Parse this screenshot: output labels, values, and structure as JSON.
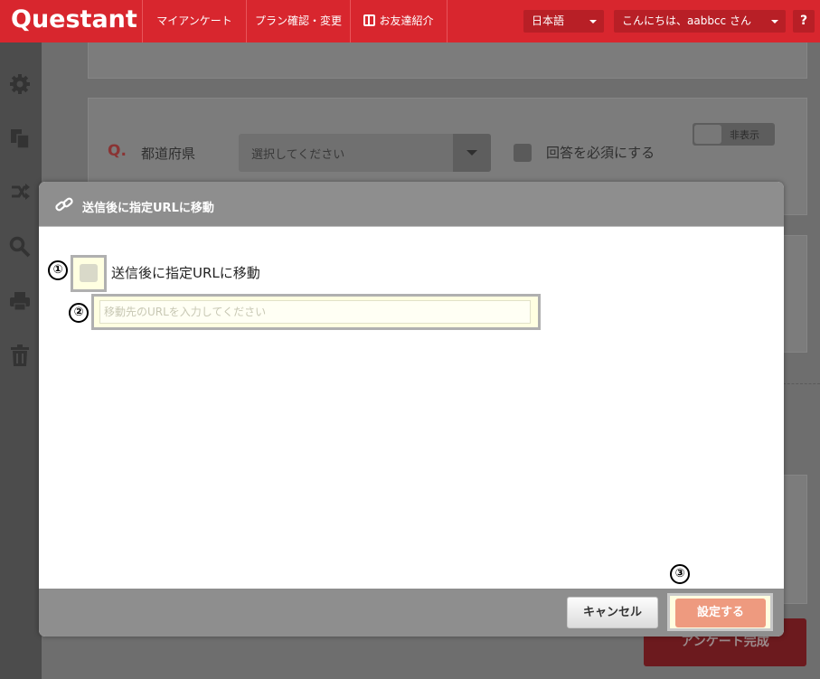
{
  "app": {
    "logo_text": "Questant",
    "nav": [
      {
        "label": "マイアンケート"
      },
      {
        "label": "プラン確認・変更"
      },
      {
        "label": "お友達紹介"
      }
    ],
    "language": "日本語",
    "greeting": "こんにちは、aabbcc さん",
    "help": "?"
  },
  "sidebar": {
    "icons": [
      "gear-icon",
      "copy-icon",
      "share-icon",
      "search-icon",
      "print-icon",
      "trash-icon"
    ]
  },
  "background": {
    "question_mark": "Q.",
    "question_label": "都道府県",
    "select_placeholder": "選択してください",
    "required_label": "回答を必須にする",
    "toggle_label": "非表示",
    "complete_button": "アンケート完成"
  },
  "modal": {
    "title": "送信後に指定URLに移動",
    "checkbox_label": "送信後に指定URLに移動",
    "url_placeholder": "移動先のURLを入力してください",
    "cancel_label": "キャンセル",
    "ok_label": "設定する",
    "step_markers": [
      "①",
      "②",
      "③"
    ]
  },
  "colors": {
    "brand_red": "#d8262e",
    "highlight": "#ffffe1",
    "ok_button": "#ee9a7f"
  }
}
